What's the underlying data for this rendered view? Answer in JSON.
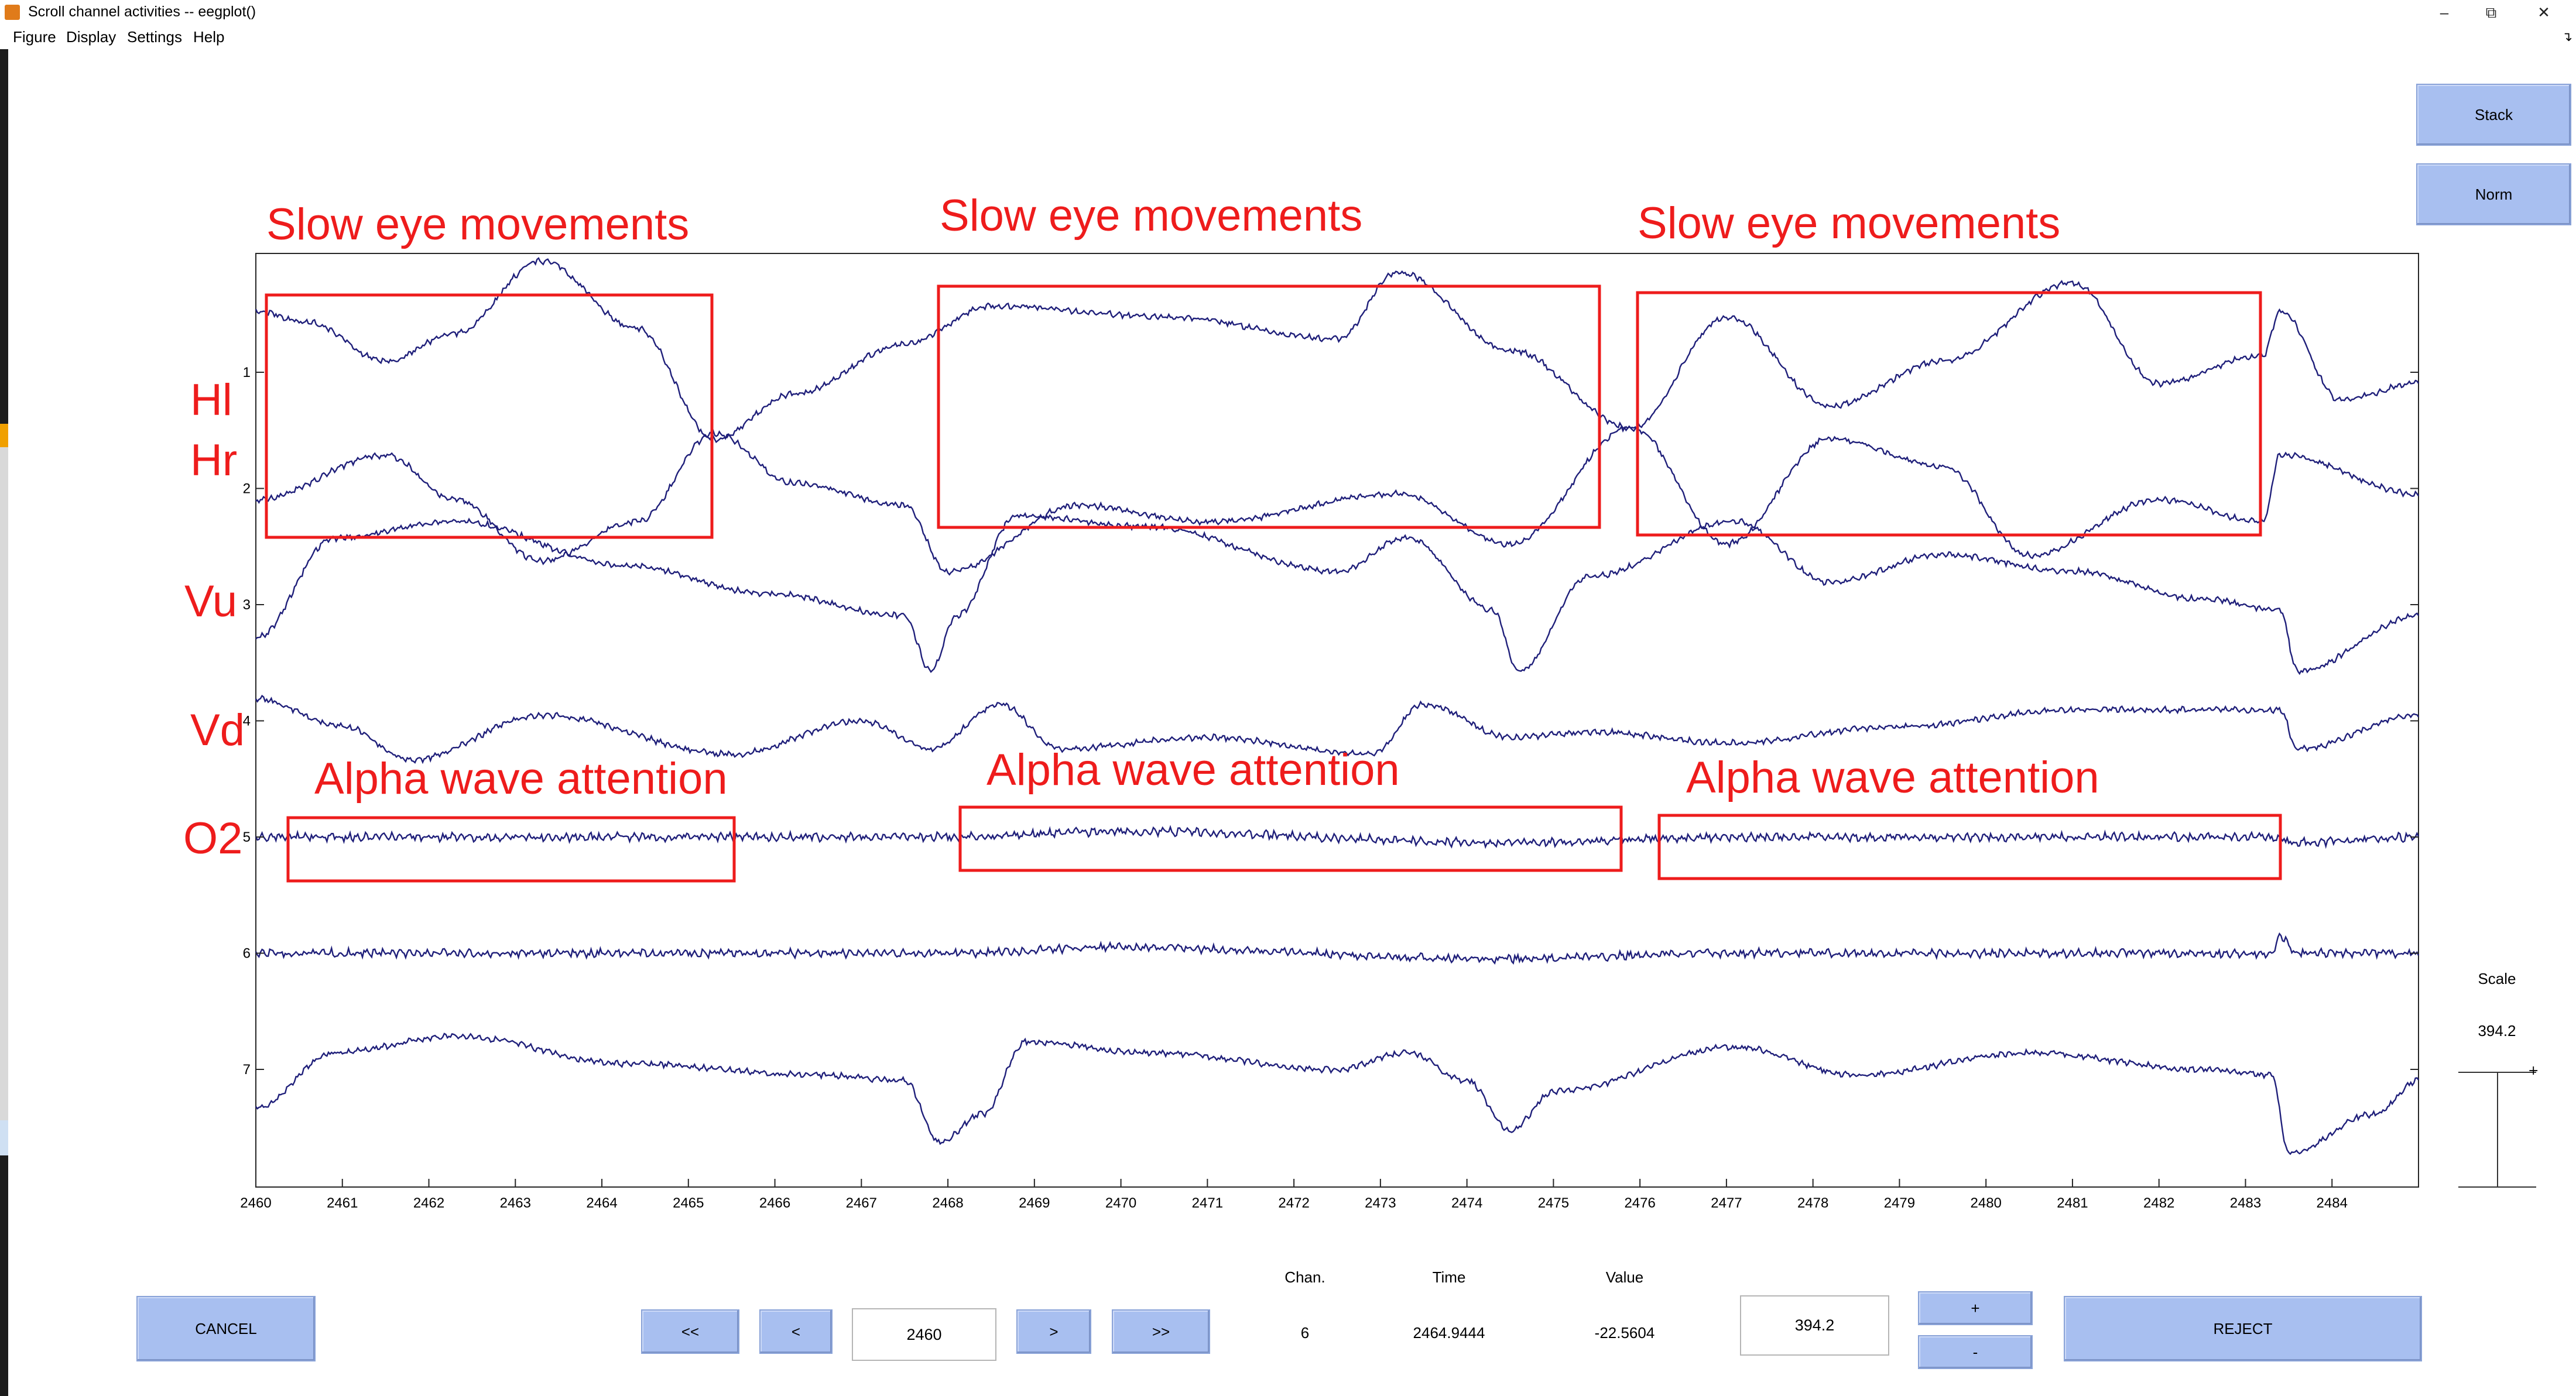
{
  "window": {
    "title": "Scroll channel activities -- eegplot()",
    "controls": [
      "–",
      "⧉",
      "✕"
    ]
  },
  "menu": [
    "Figure",
    "Display",
    "Settings",
    "Help"
  ],
  "side_buttons": {
    "stack": "Stack",
    "norm": "Norm"
  },
  "scale_panel": {
    "label": "Scale",
    "value": "394.2"
  },
  "bottom": {
    "cancel": "CANCEL",
    "nav_first": "<<",
    "nav_prev": "<",
    "position_value": "2460",
    "nav_next": ">",
    "nav_last": ">>",
    "chan_label": "Chan.",
    "time_label": "Time",
    "value_label": "Value",
    "chan_value": "6",
    "time_value": "2464.9444",
    "value_value": "-22.5604",
    "scale_value": "394.2",
    "plus": "+",
    "minus": "-",
    "reject": "REJECT"
  },
  "annotations": {
    "slow_1": "Slow eye movements",
    "slow_2": "Slow eye movements",
    "slow_3": "Slow eye movements",
    "alpha_1": "Alpha wave attention",
    "alpha_2": "Alpha wave attention",
    "alpha_3": "Alpha wave attention",
    "ch_hl": "Hl",
    "ch_hr": "Hr",
    "ch_vu": "Vu",
    "ch_vd": "Vd",
    "ch_o2": "O2"
  },
  "chart_data": {
    "type": "line",
    "x_range": [
      2460,
      2485
    ],
    "x_ticks": [
      "2460",
      "2461",
      "2462",
      "2463",
      "2464",
      "2465",
      "2466",
      "2467",
      "2468",
      "2469",
      "2470",
      "2471",
      "2472",
      "2473",
      "2474",
      "2475",
      "2476",
      "2477",
      "2478",
      "2479",
      "2480",
      "2481",
      "2482",
      "2483",
      "2484"
    ],
    "channel_ticks": [
      "1",
      "2",
      "3",
      "4",
      "5",
      "6",
      "7"
    ],
    "trace_color": "#1f1f7a",
    "annotation_color": "#ee1c1c",
    "series": [
      {
        "name": "Hl",
        "values": [
          [
            2460,
            1.1
          ],
          [
            2460.6,
            0.9
          ],
          [
            2461.5,
            0.2
          ],
          [
            2462.3,
            0.7
          ],
          [
            2463.3,
            2.0
          ],
          [
            2464.4,
            0.8
          ],
          [
            2465.3,
            -1.2
          ],
          [
            2466.2,
            -0.4
          ],
          [
            2467.5,
            0.5
          ],
          [
            2468.5,
            1.2
          ],
          [
            2470.5,
            1.0
          ],
          [
            2472.5,
            0.6
          ],
          [
            2473.2,
            1.8
          ],
          [
            2474.5,
            0.4
          ],
          [
            2475.9,
            -1.0
          ],
          [
            2477.0,
            1.0
          ],
          [
            2478.2,
            -0.6
          ],
          [
            2479.5,
            0.2
          ],
          [
            2481.0,
            1.6
          ],
          [
            2482.0,
            -0.2
          ],
          [
            2483.2,
            0.3
          ],
          [
            2483.4,
            1.1
          ],
          [
            2484.1,
            -0.5
          ],
          [
            2485,
            -0.2
          ]
        ]
      },
      {
        "name": "Hr",
        "values": [
          [
            2460,
            -0.2
          ],
          [
            2461.5,
            0.6
          ],
          [
            2462.3,
            -0.2
          ],
          [
            2463.3,
            -1.3
          ],
          [
            2464.4,
            -0.6
          ],
          [
            2465.3,
            1.0
          ],
          [
            2466.2,
            0.1
          ],
          [
            2467.5,
            -0.3
          ],
          [
            2468.0,
            -1.5
          ],
          [
            2469.5,
            -0.3
          ],
          [
            2471.0,
            -0.6
          ],
          [
            2473.2,
            -0.1
          ],
          [
            2474.5,
            -1.0
          ],
          [
            2475.9,
            1.1
          ],
          [
            2477.0,
            -1.0
          ],
          [
            2478.2,
            0.9
          ],
          [
            2479.5,
            0.4
          ],
          [
            2480.5,
            -1.2
          ],
          [
            2482.0,
            -0.2
          ],
          [
            2483.2,
            -0.6
          ],
          [
            2483.4,
            0.6
          ],
          [
            2485,
            -0.1
          ]
        ]
      },
      {
        "name": "Vu",
        "values": [
          [
            2460,
            -0.6
          ],
          [
            2460.9,
            1.2
          ],
          [
            2462.3,
            1.5
          ],
          [
            2464.3,
            0.7
          ],
          [
            2465.9,
            0.2
          ],
          [
            2467.5,
            -0.2
          ],
          [
            2467.8,
            -1.2
          ],
          [
            2468.1,
            -0.2
          ],
          [
            2468.8,
            1.6
          ],
          [
            2470.3,
            1.4
          ],
          [
            2472.5,
            0.6
          ],
          [
            2473.3,
            1.2
          ],
          [
            2474.3,
            -0.1
          ],
          [
            2474.6,
            -1.2
          ],
          [
            2475.4,
            0.5
          ],
          [
            2477.1,
            1.5
          ],
          [
            2478.2,
            0.4
          ],
          [
            2479.5,
            0.9
          ],
          [
            2481.0,
            0.6
          ],
          [
            2482.5,
            0.1
          ],
          [
            2483.4,
            -0.1
          ],
          [
            2483.6,
            -1.2
          ],
          [
            2485,
            -0.2
          ]
        ]
      },
      {
        "name": "Vd",
        "values": [
          [
            2460,
            0.4
          ],
          [
            2461.0,
            -0.1
          ],
          [
            2461.8,
            -0.7
          ],
          [
            2463.3,
            0.1
          ],
          [
            2465.5,
            -0.6
          ],
          [
            2467.0,
            0.0
          ],
          [
            2467.8,
            -0.5
          ],
          [
            2468.6,
            0.3
          ],
          [
            2469.3,
            -0.5
          ],
          [
            2471.0,
            -0.3
          ],
          [
            2472.9,
            -0.6
          ],
          [
            2473.5,
            0.3
          ],
          [
            2474.5,
            -0.3
          ],
          [
            2475.5,
            -0.2
          ],
          [
            2477.0,
            -0.4
          ],
          [
            2479.0,
            -0.1
          ],
          [
            2481.0,
            0.2
          ],
          [
            2483.4,
            0.2
          ],
          [
            2483.6,
            -0.5
          ],
          [
            2485,
            0.1
          ]
        ]
      },
      {
        "name": "O2",
        "values": [
          [
            2460,
            0.0
          ],
          [
            2465.5,
            0.0
          ],
          [
            2468.0,
            0.0
          ],
          [
            2470.0,
            0.1
          ],
          [
            2474.5,
            -0.1
          ],
          [
            2477.0,
            0.0
          ],
          [
            2483.2,
            0.0
          ],
          [
            2483.6,
            -0.1
          ],
          [
            2485,
            0.0
          ]
        ]
      },
      {
        "name": "6",
        "values": [
          [
            2460,
            0.0
          ],
          [
            2465.0,
            0.0
          ],
          [
            2468.0,
            0.0
          ],
          [
            2470.0,
            0.1
          ],
          [
            2474.5,
            -0.1
          ],
          [
            2477.0,
            0.0
          ],
          [
            2483.3,
            0.0
          ],
          [
            2483.4,
            0.3
          ],
          [
            2483.6,
            0.0
          ],
          [
            2485,
            0.0
          ]
        ]
      },
      {
        "name": "7",
        "values": [
          [
            2460,
            -0.7
          ],
          [
            2460.9,
            0.3
          ],
          [
            2462.3,
            0.6
          ],
          [
            2464.3,
            0.1
          ],
          [
            2466.5,
            -0.1
          ],
          [
            2467.5,
            -0.2
          ],
          [
            2467.9,
            -1.3
          ],
          [
            2468.4,
            -0.8
          ],
          [
            2468.9,
            0.5
          ],
          [
            2470.3,
            0.3
          ],
          [
            2472.5,
            0.0
          ],
          [
            2473.3,
            0.3
          ],
          [
            2474.0,
            -0.2
          ],
          [
            2474.5,
            -1.1
          ],
          [
            2475.0,
            -0.4
          ],
          [
            2477.1,
            0.4
          ],
          [
            2478.5,
            -0.1
          ],
          [
            2480.5,
            0.3
          ],
          [
            2482.5,
            0.0
          ],
          [
            2483.3,
            -0.1
          ],
          [
            2483.5,
            -1.5
          ],
          [
            2484.5,
            -0.8
          ],
          [
            2485,
            -0.2
          ]
        ]
      }
    ]
  }
}
